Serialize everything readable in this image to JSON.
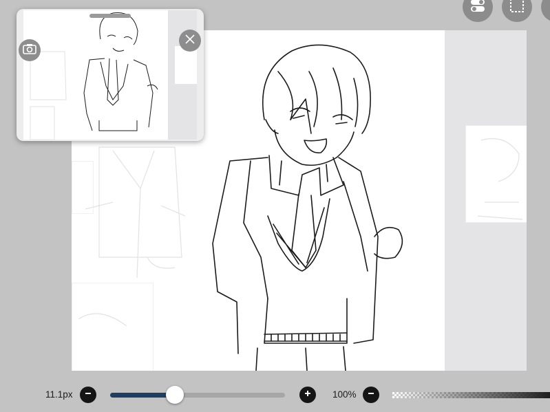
{
  "brush": {
    "size_label": "11.1px",
    "size_fraction": 0.37
  },
  "opacity": {
    "label": "100%"
  },
  "toolbar": {
    "icons": [
      "toggle-icon",
      "selection-icon",
      "more-icon"
    ]
  },
  "navigator": {
    "icons": [
      "camera-icon",
      "close-icon"
    ]
  },
  "colors": {
    "background": "#c3c3c3",
    "slider_fill": "#1f3e63",
    "button_dark": "#151515",
    "button_grey": "#8c8c8c"
  }
}
